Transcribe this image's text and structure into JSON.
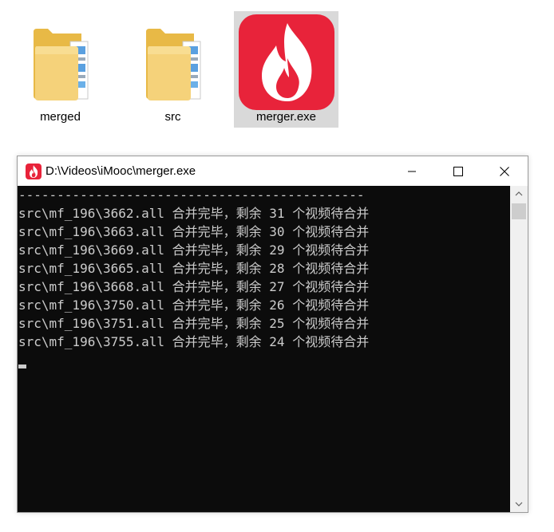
{
  "desktop": {
    "icons": [
      {
        "label": "merged",
        "type": "folder-icon"
      },
      {
        "label": "src",
        "type": "folder-icon"
      },
      {
        "label": "merger.exe",
        "type": "flame-app-icon",
        "selected": true
      }
    ]
  },
  "window": {
    "title": "D:\\Videos\\iMooc\\merger.exe",
    "controls": [
      "minimize",
      "maximize",
      "close"
    ],
    "accent_color": "#e8233a"
  },
  "console": {
    "background": "#0c0c0c",
    "text_color": "#cccccc",
    "lines": [
      "---------------------------------------------",
      "src\\mf_196\\3662.all 合并完毕，剩余 31 个视频待合并",
      "src\\mf_196\\3663.all 合并完毕，剩余 30 个视频待合并",
      "src\\mf_196\\3669.all 合并完毕，剩余 29 个视频待合并",
      "src\\mf_196\\3665.all 合并完毕，剩余 28 个视频待合并",
      "src\\mf_196\\3668.all 合并完毕，剩余 27 个视频待合并",
      "src\\mf_196\\3750.all 合并完毕，剩余 26 个视频待合并",
      "src\\mf_196\\3751.all 合并完毕，剩余 25 个视频待合并",
      "src\\mf_196\\3755.all 合并完毕，剩余 24 个视频待合并"
    ]
  }
}
